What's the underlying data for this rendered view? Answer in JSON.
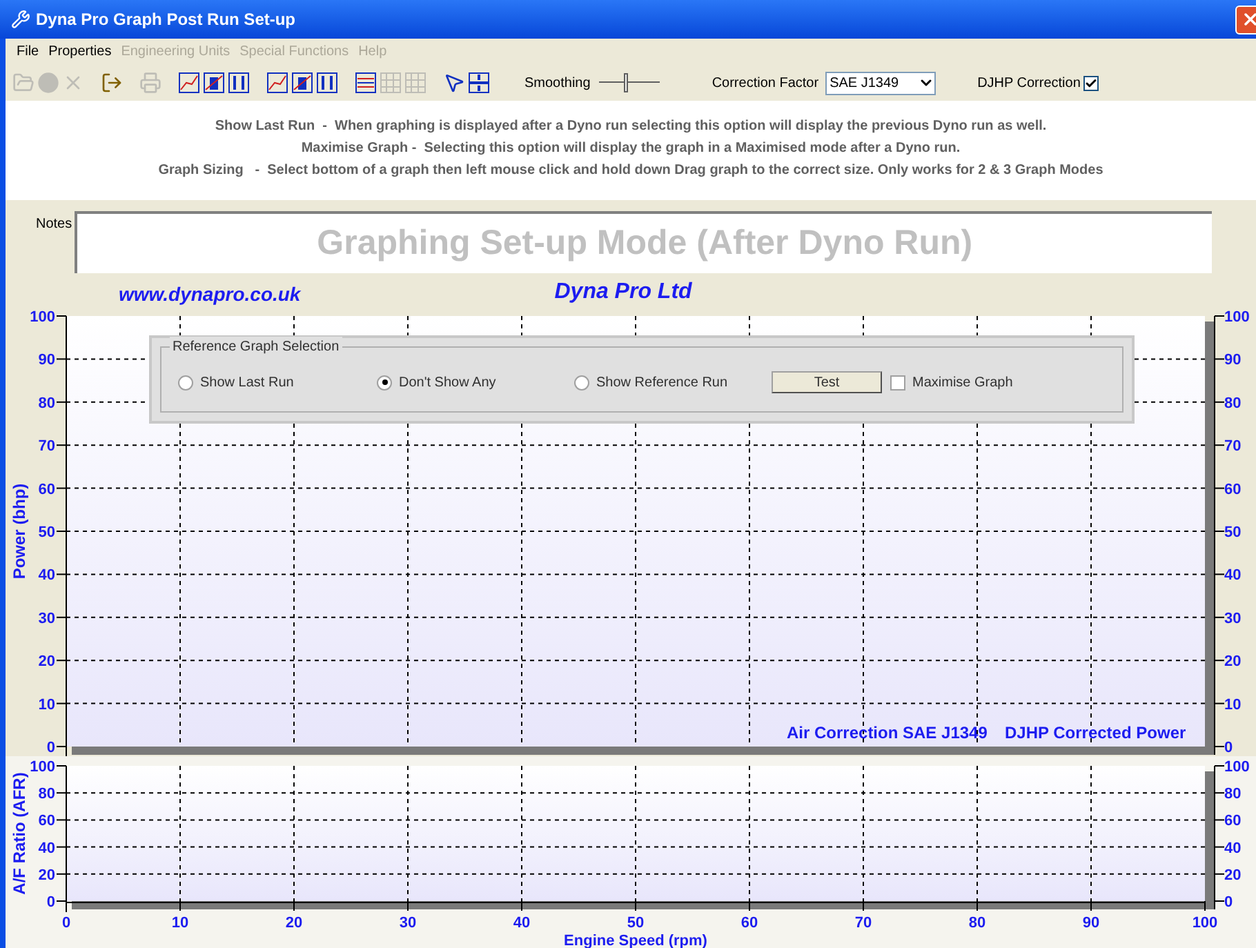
{
  "window": {
    "title": "Dyna Pro Graph Post Run Set-up"
  },
  "menu": [
    {
      "label": "File",
      "disabled": false
    },
    {
      "label": "Properties",
      "disabled": false
    },
    {
      "label": "Engineering Units",
      "disabled": true
    },
    {
      "label": "Special Functions",
      "disabled": true
    },
    {
      "label": "Help",
      "disabled": true
    }
  ],
  "toolbar": [
    [
      {
        "kind": "folder",
        "disabled": true
      },
      {
        "kind": "disc",
        "disabled": true
      },
      {
        "kind": "cross",
        "disabled": true
      }
    ],
    [
      {
        "kind": "exit",
        "disabled": false
      }
    ],
    [
      {
        "kind": "printer",
        "disabled": true
      }
    ],
    [
      {
        "kind": "graph",
        "disabled": false
      },
      {
        "kind": "graph-marked",
        "disabled": false
      },
      {
        "kind": "graph-updown",
        "disabled": false
      }
    ],
    [
      {
        "kind": "graph",
        "disabled": false
      },
      {
        "kind": "graph-marked",
        "disabled": false
      },
      {
        "kind": "graph-updown",
        "disabled": false
      }
    ],
    [
      {
        "kind": "graph-lines",
        "disabled": false
      },
      {
        "kind": "grid",
        "disabled": true
      },
      {
        "kind": "grid",
        "disabled": true
      }
    ],
    [
      {
        "kind": "pointer",
        "disabled": false
      },
      {
        "kind": "split",
        "disabled": false
      }
    ]
  ],
  "smoothing": {
    "label": "Smoothing",
    "level": 0.45
  },
  "correction_factor": {
    "label": "Correction Factor",
    "value": "SAE J1349"
  },
  "djhp_correction": {
    "label": "DJHP Correction",
    "checked": true
  },
  "info_lines": [
    "Show Last Run  -  When graphing is displayed after a Dyno run selecting this option will display the previous Dyno run as well.",
    "Maximise Graph -  Selecting this option will display the graph in a Maximised mode after a Dyno run.",
    "Graph Sizing   -  Select bottom of a graph then left mouse click and hold down Drag graph to the correct size. Only works for 2 & 3 Graph Modes"
  ],
  "notes": {
    "label": "Notes",
    "value": "Graphing Set-up Mode (After Dyno Run)"
  },
  "power_graph": {
    "website": "www.dynapro.co.uk",
    "company": "Dyna Pro Ltd",
    "footer": [
      "Air Correction SAE J1349",
      "DJHP Corrected Power"
    ],
    "right_ticks": [
      "100",
      "90",
      "80",
      "70",
      "60",
      "50",
      "40",
      "30",
      "20",
      "10",
      "0"
    ],
    "chart_data": {
      "type": "line",
      "grid": true,
      "ylabel": "Power (bhp)",
      "xlim": [
        0,
        100
      ],
      "ylim": [
        0,
        100
      ],
      "yticks": [
        0,
        10,
        20,
        30,
        40,
        50,
        60,
        70,
        80,
        90,
        100
      ]
    }
  },
  "reference_panel": {
    "title": "Reference Graph Selection",
    "options": [
      {
        "label": "Show Last Run",
        "selected": false
      },
      {
        "label": "Don't Show Any",
        "selected": true
      },
      {
        "label": "Show Reference Run",
        "selected": false
      }
    ],
    "test_button": "Test",
    "maximise": {
      "label": "Maximise Graph",
      "checked": false
    }
  },
  "afr_graph": {
    "right_ticks": [
      "100",
      "80",
      "60",
      "40",
      "20",
      "0"
    ],
    "chart_data": {
      "type": "line",
      "grid": true,
      "xlabel": "Engine Speed (rpm)",
      "ylabel": "A/F Ratio (AFR)",
      "xlim": [
        0,
        100
      ],
      "ylim": [
        0,
        100
      ],
      "xticks": [
        0,
        10,
        20,
        30,
        40,
        50,
        60,
        70,
        80,
        90,
        100
      ],
      "yticks": [
        0,
        20,
        40,
        60,
        80,
        100
      ]
    }
  }
}
